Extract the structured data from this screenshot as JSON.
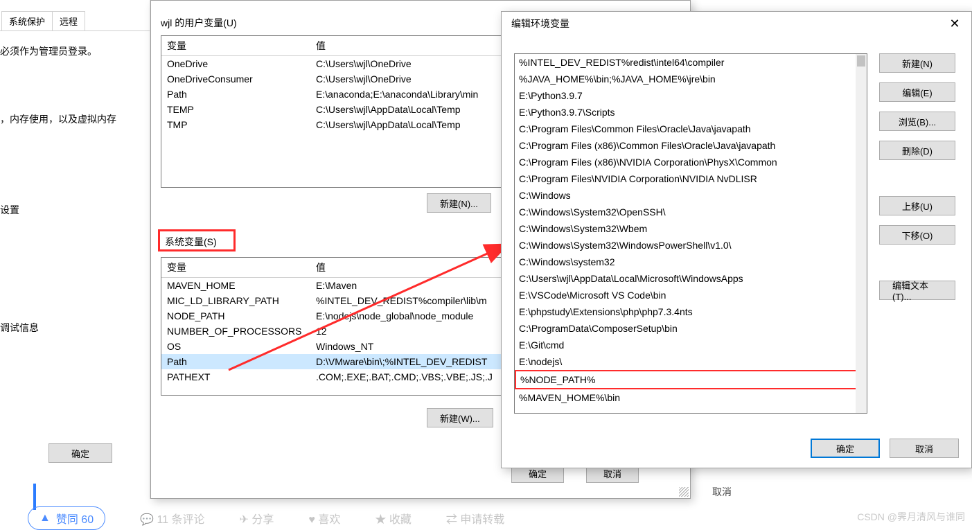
{
  "left_panel": {
    "tab1": "系统保护",
    "tab2": "远程",
    "line1": "必须作为管理员登录。",
    "line2": "，内存使用，以及虚拟内存",
    "line3": "设置",
    "line4": "调试信息",
    "ok": "确定"
  },
  "env": {
    "user_section": "wjl 的用户变量(U)",
    "sys_section": "系统变量(S)",
    "col_var": "变量",
    "col_val": "值",
    "user_vars": [
      {
        "n": "OneDrive",
        "v": "C:\\Users\\wjl\\OneDrive"
      },
      {
        "n": "OneDriveConsumer",
        "v": "C:\\Users\\wjl\\OneDrive"
      },
      {
        "n": "Path",
        "v": "E:\\anaconda;E:\\anaconda\\Library\\min"
      },
      {
        "n": "TEMP",
        "v": "C:\\Users\\wjl\\AppData\\Local\\Temp"
      },
      {
        "n": "TMP",
        "v": "C:\\Users\\wjl\\AppData\\Local\\Temp"
      }
    ],
    "sys_vars": [
      {
        "n": "MAVEN_HOME",
        "v": "E:\\Maven"
      },
      {
        "n": "MIC_LD_LIBRARY_PATH",
        "v": "%INTEL_DEV_REDIST%compiler\\lib\\m"
      },
      {
        "n": "NODE_PATH",
        "v": "E:\\nodejs\\node_global\\node_module"
      },
      {
        "n": "NUMBER_OF_PROCESSORS",
        "v": "12"
      },
      {
        "n": "OS",
        "v": "Windows_NT"
      },
      {
        "n": "Path",
        "v": "D:\\VMware\\bin\\;%INTEL_DEV_REDIST",
        "sel": true
      },
      {
        "n": "PATHEXT",
        "v": ".COM;.EXE;.BAT;.CMD;.VBS;.VBE;.JS;.J"
      }
    ],
    "btn_new_n": "新建(N)...",
    "btn_new_w": "新建(W)...",
    "btn_ok": "确定",
    "btn_cancel": "取消"
  },
  "edit": {
    "title": "编辑环境变量",
    "paths": [
      "%INTEL_DEV_REDIST%redist\\intel64\\compiler",
      "%JAVA_HOME%\\bin;%JAVA_HOME%\\jre\\bin",
      "E:\\Python3.9.7",
      "E:\\Python3.9.7\\Scripts",
      "C:\\Program Files\\Common Files\\Oracle\\Java\\javapath",
      "C:\\Program Files (x86)\\Common Files\\Oracle\\Java\\javapath",
      "C:\\Program Files (x86)\\NVIDIA Corporation\\PhysX\\Common",
      "C:\\Program Files\\NVIDIA Corporation\\NVIDIA NvDLISR",
      "C:\\Windows",
      "C:\\Windows\\System32\\OpenSSH\\",
      "C:\\Windows\\System32\\Wbem",
      "C:\\Windows\\System32\\WindowsPowerShell\\v1.0\\",
      "C:\\Windows\\system32",
      "C:\\Users\\wjl\\AppData\\Local\\Microsoft\\WindowsApps",
      "E:\\VSCode\\Microsoft VS Code\\bin",
      "E:\\phpstudy\\Extensions\\php\\php7.3.4nts",
      "C:\\ProgramData\\ComposerSetup\\bin",
      "E:\\Git\\cmd",
      "E:\\nodejs\\",
      "%NODE_PATH%",
      "%MAVEN_HOME%\\bin"
    ],
    "hl_index": 19,
    "btn_new": "新建(N)",
    "btn_edit": "编辑(E)",
    "btn_browse": "浏览(B)...",
    "btn_delete": "删除(D)",
    "btn_up": "上移(U)",
    "btn_down": "下移(O)",
    "btn_text": "编辑文本(T)...",
    "btn_ok": "确定",
    "btn_cancel": "取消"
  },
  "float_cancel": "取消",
  "blog": {
    "like": "赞同 60",
    "comments": "11 条评论",
    "share": "分享",
    "love": "喜欢",
    "fav": "收藏",
    "repost": "申请转载"
  },
  "watermark": "CSDN @霁月清风与谁同"
}
